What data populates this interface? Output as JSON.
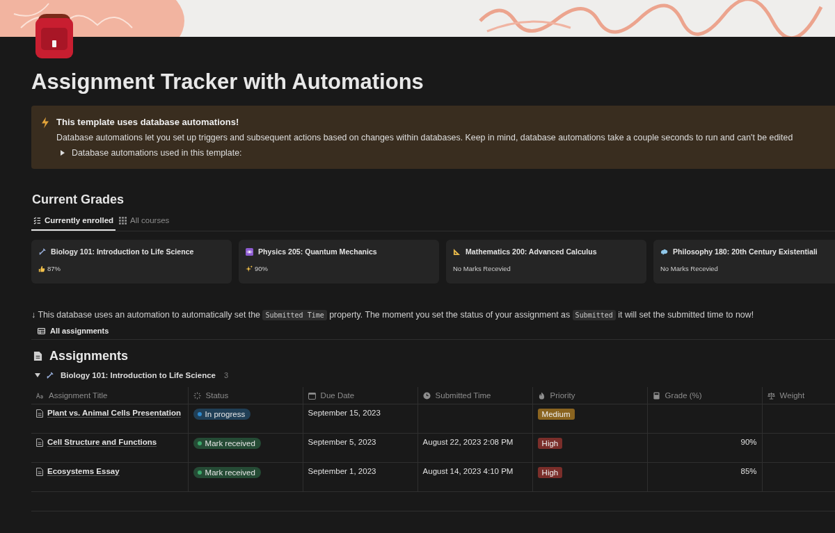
{
  "page": {
    "title": "Assignment Tracker with Automations"
  },
  "callout": {
    "title": "This template uses database automations!",
    "body": "Database automations let you set up triggers and subsequent actions based on changes within databases. Keep in mind, database automations take a couple seconds to run and can't be edited",
    "toggle": {
      "label": "Database automations used in this template:",
      "expanded": false
    }
  },
  "grades": {
    "heading": "Current Grades",
    "tabs": [
      {
        "label": "Currently enrolled",
        "selected": true
      },
      {
        "label": "All courses",
        "selected": false
      }
    ],
    "cards": [
      {
        "course": "Biology 101: Introduction to Life Science",
        "grade": "87%"
      },
      {
        "course": "Physics 205: Quantum Mechanics",
        "grade": "90%"
      },
      {
        "course": "Mathematics 200: Advanced Calculus",
        "grade": "No Marks Recevied"
      },
      {
        "course": "Philosophy 180: 20th Century Existentiali",
        "grade": "No Marks Recevied"
      }
    ]
  },
  "note": [
    {
      "kind": "text",
      "text": "↓ This database uses an automation to automatically set the "
    },
    {
      "kind": "code",
      "text": "Submitted Time"
    },
    {
      "kind": "text",
      "text": " property. The moment you set the status of your assignment as "
    },
    {
      "kind": "code",
      "text": "Submitted"
    },
    {
      "kind": "text",
      "text": " it will set the submitted time to now!"
    }
  ],
  "view_tab": {
    "label": "All assignments",
    "selected": true
  },
  "assignments": {
    "heading": "Assignments",
    "group": {
      "label": "Biology 101: Introduction to Life Science",
      "count": "3",
      "expanded": true
    },
    "columns": [
      "Assignment Title",
      "Status",
      "Due Date",
      "Submitted Time",
      "Priority",
      "Grade (%)",
      "Weight"
    ],
    "rows": [
      {
        "title": "Plant vs. Animal Cells Presentation",
        "status": {
          "label": "In progress",
          "color": "#2f87c9"
        },
        "due": "September 15, 2023",
        "submitted": "",
        "priority": {
          "label": "Medium",
          "color": "#8a6420"
        },
        "grade": ""
      },
      {
        "title": "Cell Structure and Functions",
        "status": {
          "label": "Mark received",
          "color": "#3ca86a"
        },
        "due": "September 5, 2023",
        "submitted": "August 22, 2023 2:08 PM",
        "priority": {
          "label": "High",
          "color": "#7a2e2a"
        },
        "grade": "90%"
      },
      {
        "title": "Ecosystems Essay",
        "status": {
          "label": "Mark received",
          "color": "#3ca86a"
        },
        "due": "September 1, 2023",
        "submitted": "August 14, 2023 4:10 PM",
        "priority": {
          "label": "High",
          "color": "#7a2e2a"
        },
        "grade": "85%"
      }
    ]
  }
}
